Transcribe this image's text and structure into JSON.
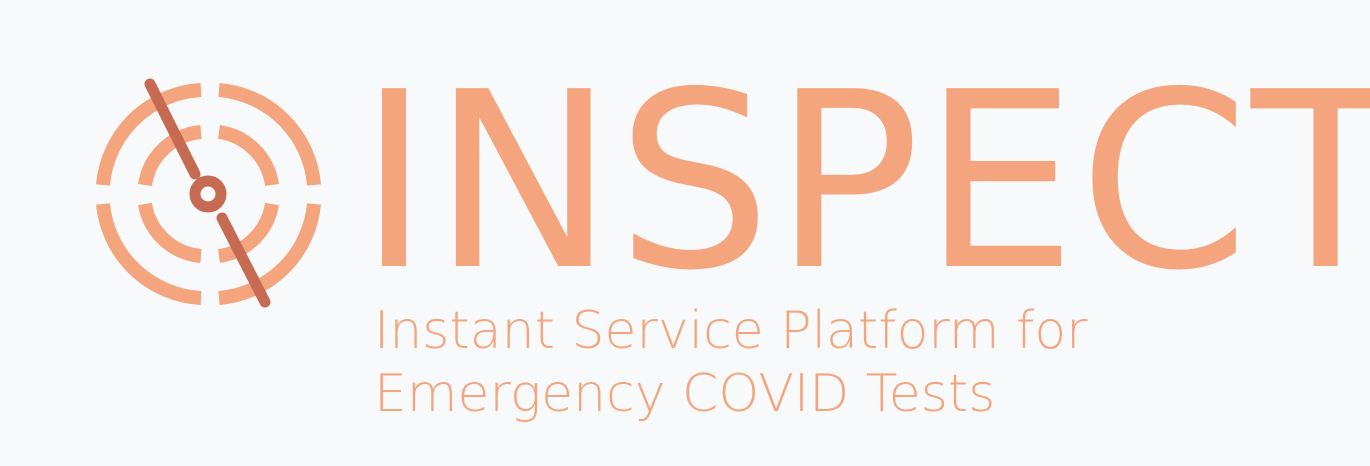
{
  "brand": {
    "name": "INSPECT",
    "tagline_line1": "Instant Service Platform for",
    "tagline_line2": "Emergency COVID Tests"
  },
  "colors": {
    "background": "#f8f9fa",
    "primary": "#f4a57d",
    "accent": "#c76a52"
  },
  "icons": {
    "logo": "target-crosshair-icon"
  }
}
